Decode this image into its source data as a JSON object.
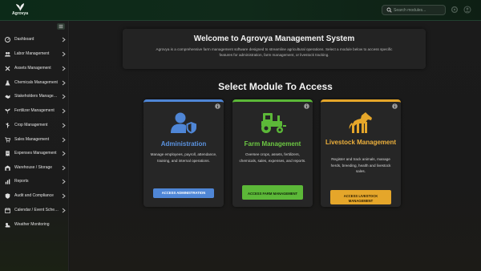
{
  "app": {
    "logo_text": "Agrovya"
  },
  "search": {
    "placeholder": "Search modules..."
  },
  "colors": {
    "admin": "#4f86d6",
    "farm": "#5cb838",
    "livestock": "#e5a62a",
    "topbar": "#0c2a18"
  },
  "sidebar": {
    "items": [
      {
        "label": "Dashboard",
        "icon": "dashboard-icon"
      },
      {
        "label": "Labor Management",
        "icon": "users-icon"
      },
      {
        "label": "Assets Management",
        "icon": "tools-icon"
      },
      {
        "label": "Chemicals Management",
        "icon": "flask-icon"
      },
      {
        "label": "Stakeholders Management",
        "icon": "handshake-icon"
      },
      {
        "label": "Fertilizer Management",
        "icon": "seedling-icon"
      },
      {
        "label": "Crop Management",
        "icon": "crop-icon"
      },
      {
        "label": "Sales Management",
        "icon": "cart-icon"
      },
      {
        "label": "Expenses Management",
        "icon": "receipt-icon"
      },
      {
        "label": "Warehouse / Storage",
        "icon": "warehouse-icon"
      },
      {
        "label": "Reports",
        "icon": "report-icon"
      },
      {
        "label": "Audit and Compliance",
        "icon": "shield-icon"
      },
      {
        "label": "Calendar / Event Scheduler",
        "icon": "calendar-icon"
      },
      {
        "label": "Weather Monitoring",
        "icon": "weather-icon"
      }
    ]
  },
  "welcome": {
    "title": "Welcome to Agrovya Management System",
    "description": "Agrovya is a comprehensive farm management software designed to streamline agricultural operations. Select a module below to access specific features for administration, farm management, or livestock tracking."
  },
  "section_title": "Select Module To Access",
  "modules": {
    "admin": {
      "title": "Administration",
      "description": "Manage employees, payroll, attendance, training, and internal operations.",
      "button": "ACCESS ADMINISTRATION"
    },
    "farm": {
      "title": "Farm Management",
      "description": "Oversee crops, assets, fertilizers, chemicals, sales, expenses, and reports.",
      "button": "ACCESS FARM MANAGEMENT"
    },
    "livestock": {
      "title": "Livestock Management",
      "description": "Register and track animals, manage herds, breeding, health and livestock sales.",
      "button": "ACCESS LIVESTOCK MANAGEMENT"
    }
  }
}
